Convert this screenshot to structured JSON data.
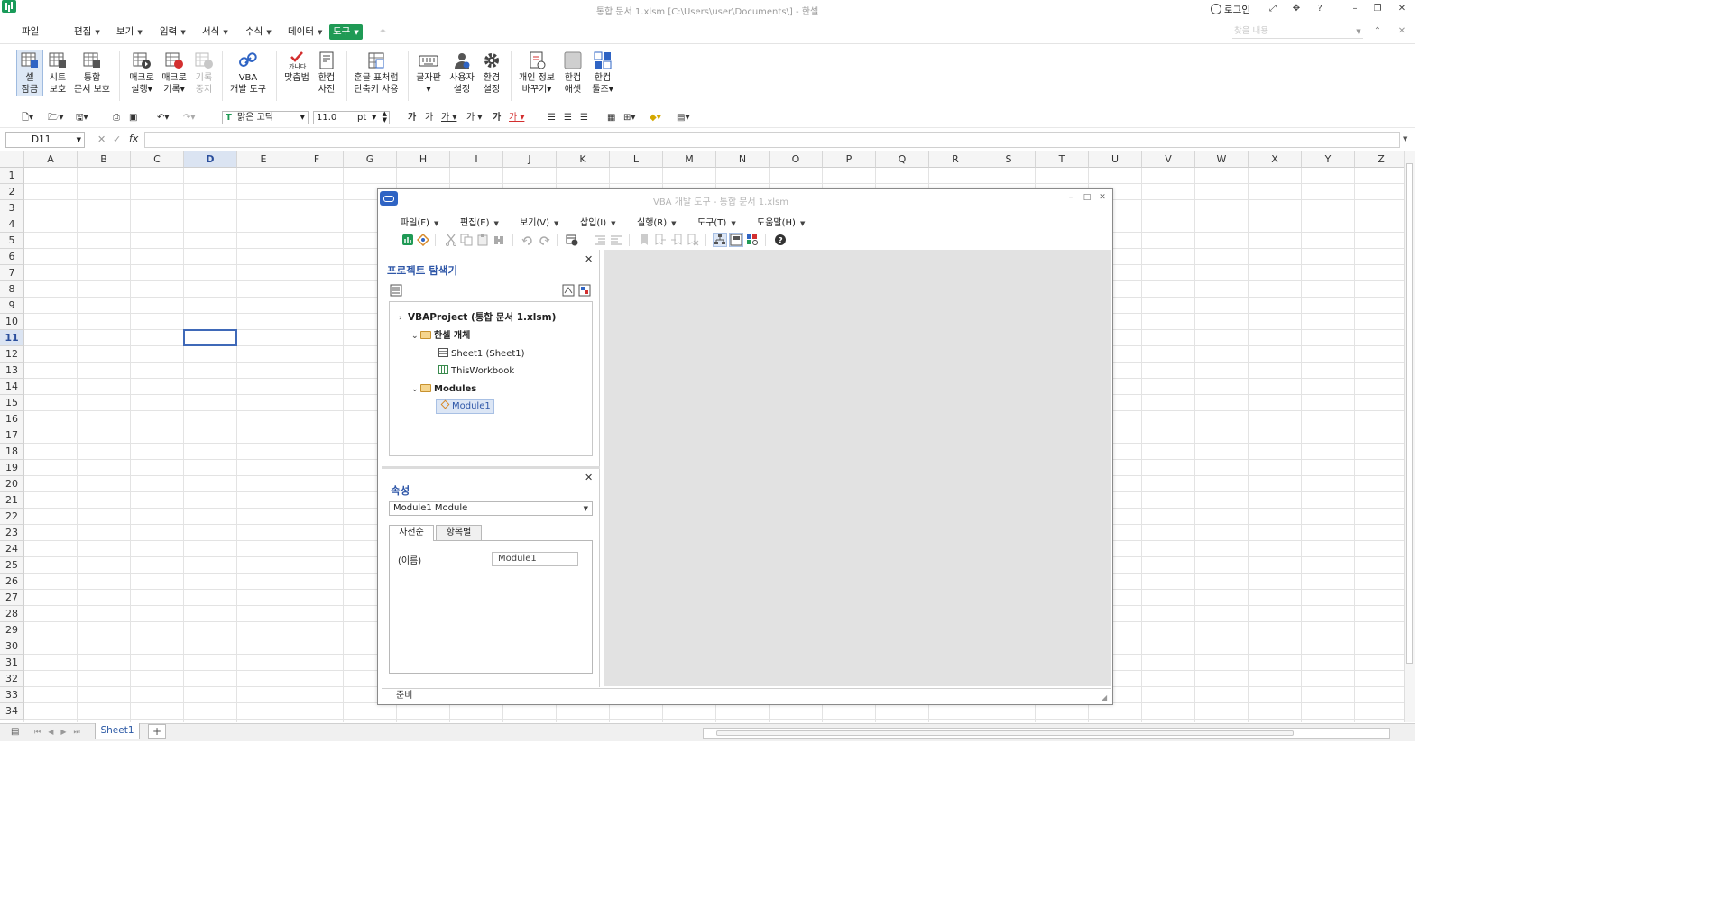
{
  "window": {
    "title": "통합 문서 1.xlsm [C:\\Users\\user\\Documents\\] - 한셀",
    "login": "로그인"
  },
  "menu": {
    "items": [
      {
        "label": "파일",
        "caret": false
      },
      {
        "label": "편집",
        "caret": true
      },
      {
        "label": "보기",
        "caret": true
      },
      {
        "label": "입력",
        "caret": true
      },
      {
        "label": "서식",
        "caret": true
      },
      {
        "label": "수식",
        "caret": true
      },
      {
        "label": "데이터",
        "caret": true
      },
      {
        "label": "도구",
        "caret": true,
        "active": true
      }
    ],
    "search_placeholder": "찾을 내용"
  },
  "ribbon": {
    "buttons": [
      {
        "label1": "셀",
        "label2": "잠금",
        "selected": true
      },
      {
        "label1": "시트",
        "label2": "보호"
      },
      {
        "label1": "통합",
        "label2": "문서 보호"
      },
      {
        "label1": "매크로",
        "label2": "실행"
      },
      {
        "label1": "매크로",
        "label2": "기록"
      },
      {
        "label1": "기록",
        "label2": "중지",
        "disabled": true
      },
      {
        "label1": "VBA",
        "label2": "개발 도구"
      },
      {
        "label1": "맞춤법",
        "label2": ""
      },
      {
        "label1": "한컴",
        "label2": "사전"
      },
      {
        "label1": "훈글 표처럼",
        "label2": "단축키 사용"
      },
      {
        "label1": "글자판",
        "label2": ""
      },
      {
        "label1": "사용자",
        "label2": "설정"
      },
      {
        "label1": "환경",
        "label2": "설정"
      },
      {
        "label1": "개인 정보",
        "label2": "바꾸기"
      },
      {
        "label1": "한컴",
        "label2": "애셋"
      },
      {
        "label1": "한컴",
        "label2": "툴즈"
      }
    ]
  },
  "format": {
    "font": "맑은 고딕",
    "size": "11.0",
    "unit": "pt"
  },
  "formula": {
    "namebox": "D11",
    "fx": "fx"
  },
  "grid": {
    "columns": [
      "A",
      "B",
      "C",
      "D",
      "E",
      "F",
      "G",
      "H",
      "I",
      "J",
      "K",
      "L",
      "M",
      "N",
      "O",
      "P",
      "Q",
      "R",
      "S",
      "T",
      "U",
      "V",
      "W",
      "X",
      "Y",
      "Z"
    ],
    "rows": [
      "1",
      "2",
      "3",
      "4",
      "5",
      "6",
      "7",
      "8",
      "9",
      "10",
      "11",
      "12",
      "13",
      "14",
      "15",
      "16",
      "17",
      "18",
      "19",
      "20",
      "21",
      "22",
      "23",
      "24",
      "25",
      "26",
      "27",
      "28",
      "29",
      "30",
      "31",
      "32",
      "33",
      "34"
    ],
    "active_col": "D",
    "active_row": "11"
  },
  "sheets": {
    "active": "Sheet1",
    "add": "+"
  },
  "vba": {
    "title": "VBA 개발 도구 - 통합 문서 1.xlsm",
    "menu": [
      "파일(F)",
      "편집(E)",
      "보기(V)",
      "삽입(I)",
      "실행(R)",
      "도구(T)",
      "도움말(H)"
    ],
    "project_title": "프로젝트 탐색기",
    "tree": {
      "root": "VBAProject (통합 문서 1.xlsm)",
      "folder1": "한셀 개체",
      "sheet1": "Sheet1 (Sheet1)",
      "workbook": "ThisWorkbook",
      "folder2": "Modules",
      "module1": "Module1"
    },
    "props_title": "속성",
    "props_combo": "Module1 Module",
    "props_tabs": [
      "사전순",
      "항목별"
    ],
    "prop_name": "(이름)",
    "prop_value": "Module1",
    "status": "준비"
  }
}
